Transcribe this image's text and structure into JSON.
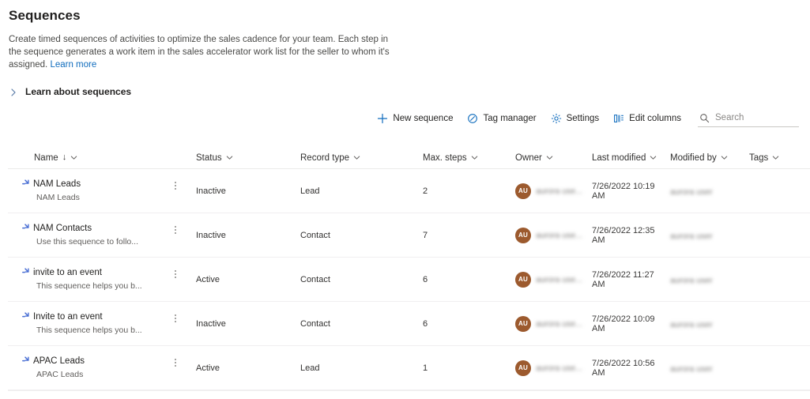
{
  "page": {
    "title": "Sequences",
    "description": "Create timed sequences of activities to optimize the sales cadence for your team. Each step in the sequence generates a work item in the sales accelerator work list for the seller to whom it's assigned.",
    "learn_more_label": "Learn more",
    "expander_label": "Learn about sequences",
    "expander_icon": "chevron-right-icon"
  },
  "commandbar": {
    "new_sequence": {
      "label": "New sequence",
      "icon": "plus-icon"
    },
    "tag_manager": {
      "label": "Tag manager",
      "icon": "tag-icon"
    },
    "settings": {
      "label": "Settings",
      "icon": "gear-icon"
    },
    "edit_columns": {
      "label": "Edit columns",
      "icon": "columns-icon"
    },
    "search": {
      "placeholder": "Search",
      "value": "",
      "icon": "search-icon"
    }
  },
  "grid": {
    "columns": [
      {
        "label": "Name",
        "sort": "↓",
        "icon": "chevron-down-icon"
      },
      {
        "label": "Status",
        "icon": "chevron-down-icon"
      },
      {
        "label": "Record type",
        "icon": "chevron-down-icon"
      },
      {
        "label": "Max. steps",
        "icon": "chevron-down-icon"
      },
      {
        "label": "Owner",
        "icon": "chevron-down-icon"
      },
      {
        "label": "Last modified",
        "icon": "chevron-down-icon"
      },
      {
        "label": "Modified by",
        "icon": "chevron-down-icon"
      },
      {
        "label": "Tags",
        "icon": "chevron-down-icon"
      }
    ],
    "rows": [
      {
        "name": "NAM Leads",
        "subtitle": "NAM Leads",
        "icon": "sequence-icon",
        "status": "Inactive",
        "record_type": "Lead",
        "max_steps": "2",
        "owner_initials": "AU",
        "owner": "aurora use...",
        "last_modified": "7/26/2022 10:19 AM",
        "modified_by": "aurora user",
        "tags": ""
      },
      {
        "name": "NAM Contacts",
        "subtitle": "Use this sequence to follo...",
        "icon": "sequence-icon",
        "status": "Inactive",
        "record_type": "Contact",
        "max_steps": "7",
        "owner_initials": "AU",
        "owner": "aurora use...",
        "last_modified": "7/26/2022 12:35 AM",
        "modified_by": "aurora user",
        "tags": ""
      },
      {
        "name": "invite to an event",
        "subtitle": "This sequence helps you b...",
        "icon": "sequence-icon",
        "status": "Active",
        "record_type": "Contact",
        "max_steps": "6",
        "owner_initials": "AU",
        "owner": "aurora use...",
        "last_modified": "7/26/2022 11:27 AM",
        "modified_by": "aurora user",
        "tags": ""
      },
      {
        "name": "Invite to an event",
        "subtitle": "This sequence helps you b...",
        "icon": "sequence-icon",
        "status": "Inactive",
        "record_type": "Contact",
        "max_steps": "6",
        "owner_initials": "AU",
        "owner": "aurora use...",
        "last_modified": "7/26/2022 10:09 AM",
        "modified_by": "aurora user",
        "tags": ""
      },
      {
        "name": "APAC Leads",
        "subtitle": "APAC Leads",
        "icon": "sequence-icon",
        "status": "Active",
        "record_type": "Lead",
        "max_steps": "1",
        "owner_initials": "AU",
        "owner": "aurora use...",
        "last_modified": "7/26/2022 10:56 AM",
        "modified_by": "aurora user",
        "tags": ""
      }
    ]
  },
  "colors": {
    "link": "#0f6cbd",
    "accent_icon": "#0f6cbd",
    "avatar": "#9c5a2e",
    "sequence_icon": "#4a6fd4"
  }
}
